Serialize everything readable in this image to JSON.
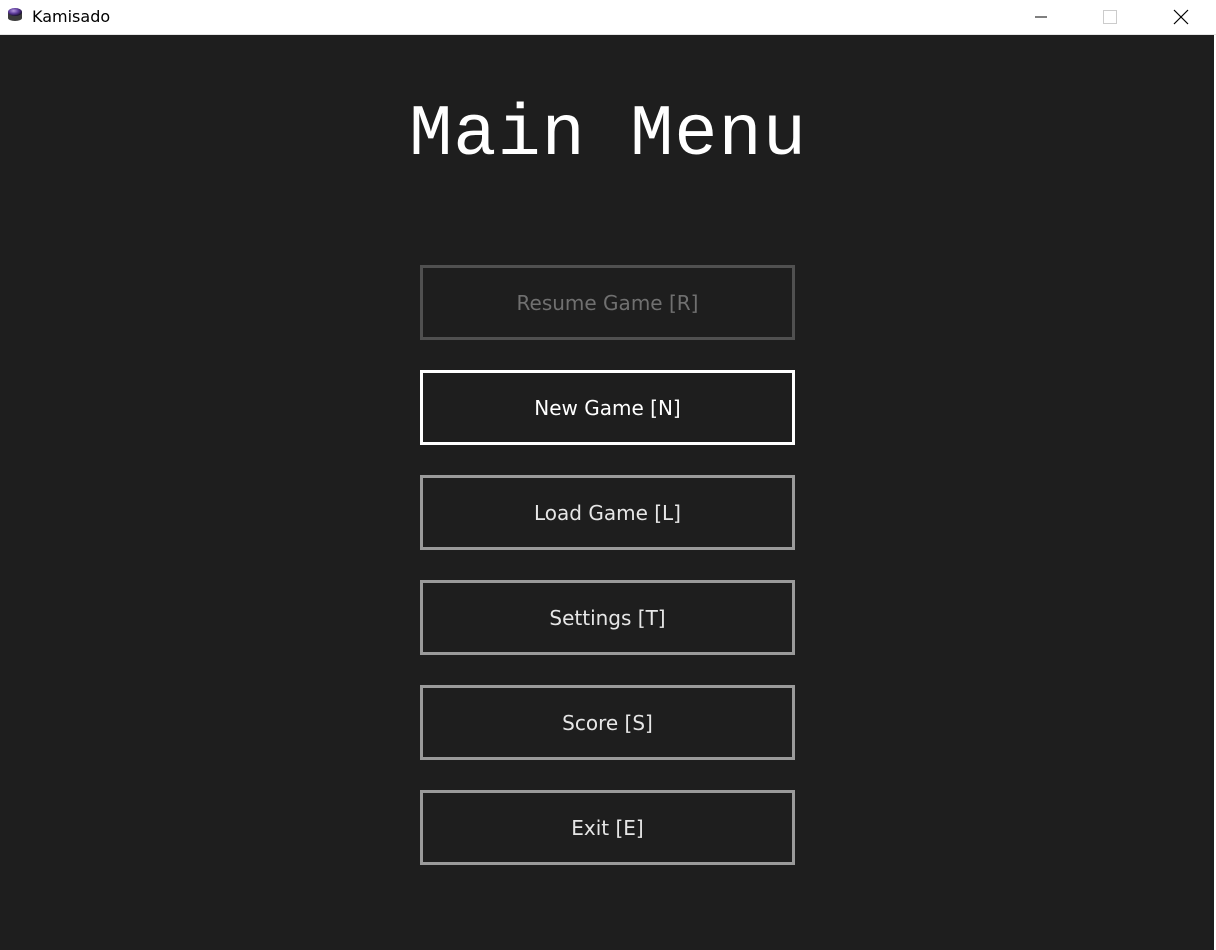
{
  "window": {
    "title": "Kamisado",
    "icon": "kamisado-app-icon",
    "controls": {
      "minimize_icon": "minimize-icon",
      "maximize_icon": "maximize-icon",
      "close_icon": "close-icon"
    }
  },
  "menu": {
    "title": "Main Menu",
    "buttons": [
      {
        "label": "Resume Game [R]",
        "state": "disabled"
      },
      {
        "label": "New Game [N]",
        "state": "selected"
      },
      {
        "label": "Load Game [L]",
        "state": "normal"
      },
      {
        "label": "Settings [T]",
        "state": "normal"
      },
      {
        "label": "Score [S]",
        "state": "normal"
      },
      {
        "label": "Exit [E]",
        "state": "normal"
      }
    ]
  },
  "colors": {
    "background": "#1e1e1e",
    "button_border": "#9a9a9a",
    "button_border_selected": "#ffffff",
    "button_border_disabled": "#505050",
    "text": "#e6e6e6",
    "text_disabled": "#707070"
  }
}
